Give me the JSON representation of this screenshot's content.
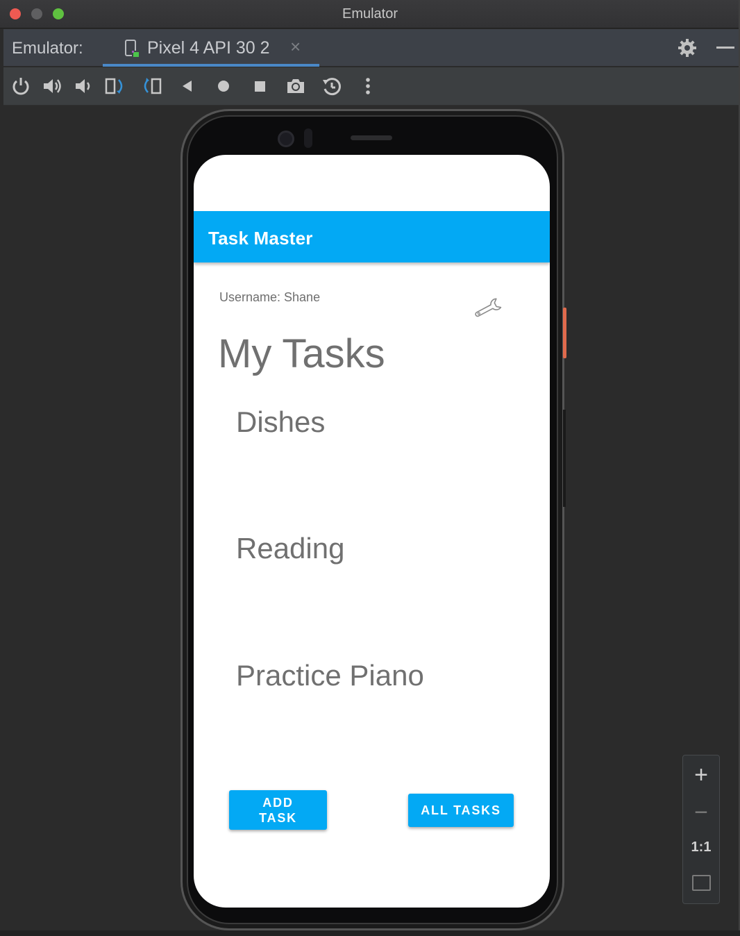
{
  "window": {
    "title": "Emulator"
  },
  "tabbar": {
    "label": "Emulator:",
    "active_tab": {
      "label": "Pixel 4 API 30 2",
      "close_glyph": "×"
    }
  },
  "toolbar": {
    "buttons": [
      "power-icon",
      "volume-up-icon",
      "volume-down-icon",
      "rotate-left-icon",
      "rotate-right-icon",
      "back-icon",
      "home-icon",
      "overview-icon",
      "screenshot-icon",
      "snapshot-icon",
      "more-icon"
    ]
  },
  "app": {
    "title": "Task Master",
    "username": "Username: Shane",
    "heading": "My Tasks",
    "tasks": [
      "Dishes",
      "Reading",
      "Practice Piano"
    ],
    "add_task_label": "ADD TASK",
    "all_tasks_label": "ALL TASKS",
    "accent_color": "#03a9f4"
  },
  "zoom": {
    "in": "+",
    "out": "−",
    "actual": "1:1"
  }
}
